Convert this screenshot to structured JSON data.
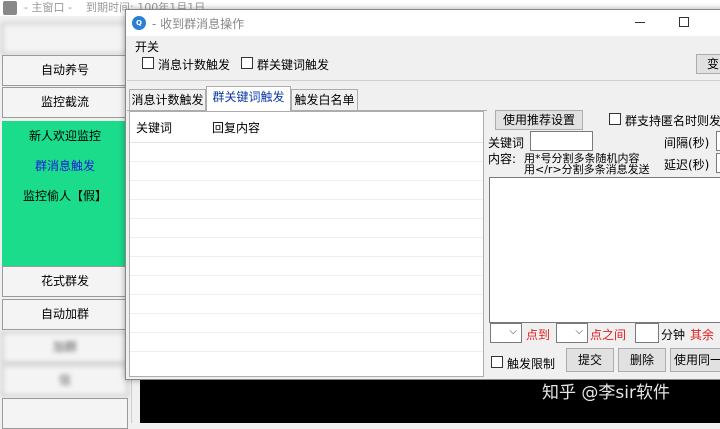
{
  "main_window": {
    "title": "- 主窗口 -",
    "expire_text": "到期时间: 100年1月1日",
    "nav": [
      {
        "label": "",
        "blurred": true
      },
      {
        "label": "自动养号",
        "blurred": false
      },
      {
        "label": "监控截流",
        "blurred": false
      }
    ],
    "green_items": [
      {
        "label": "新人欢迎监控",
        "color": "#000000"
      },
      {
        "label": "群消息触发",
        "color": "#1a1adc"
      },
      {
        "label": "监控偷人【假】",
        "color": "#000000"
      }
    ],
    "nav_bottom": [
      {
        "label": "花式群发",
        "blurred": false
      },
      {
        "label": "自动加群",
        "blurred": false
      },
      {
        "label": "加群",
        "blurred": true
      },
      {
        "label": "信",
        "blurred": true
      },
      {
        "label": "",
        "blurred": false
      }
    ],
    "accent_green": "#1adc8a"
  },
  "dialog": {
    "title": "- 收到群消息操作",
    "switch_label": "开关",
    "checkbox_msg_count": "消息计数触发",
    "checkbox_group_keyword": "群关键词触发",
    "top_right_button": "变",
    "tabs": [
      {
        "label": "消息计数触发",
        "active": false
      },
      {
        "label": "群关键词触发",
        "active": true
      },
      {
        "label": "触发白名单",
        "active": false
      }
    ],
    "table": {
      "columns": [
        "关键词",
        "回复内容"
      ],
      "rows": []
    },
    "form": {
      "use_recommended_button": "使用推荐设置",
      "anonymous_checkbox": "群支持匿名时则发",
      "keyword_label": "关键词",
      "interval_label": "间隔(秒)",
      "content_label": "内容:",
      "content_hint_1": "用*号分割多条随机内容",
      "content_hint_2": "用</r>分割多条消息发送",
      "delay_label": "延迟(秒)",
      "point_to_label": "点到",
      "point_between_label": "点之间",
      "minute_label": "分钟",
      "remaining_label": "其余",
      "trigger_limit_checkbox": "触发限制",
      "submit_button": "提交",
      "delete_button": "删除",
      "use_same_button": "使用同一"
    }
  },
  "watermark": "知乎 @李sir软件"
}
